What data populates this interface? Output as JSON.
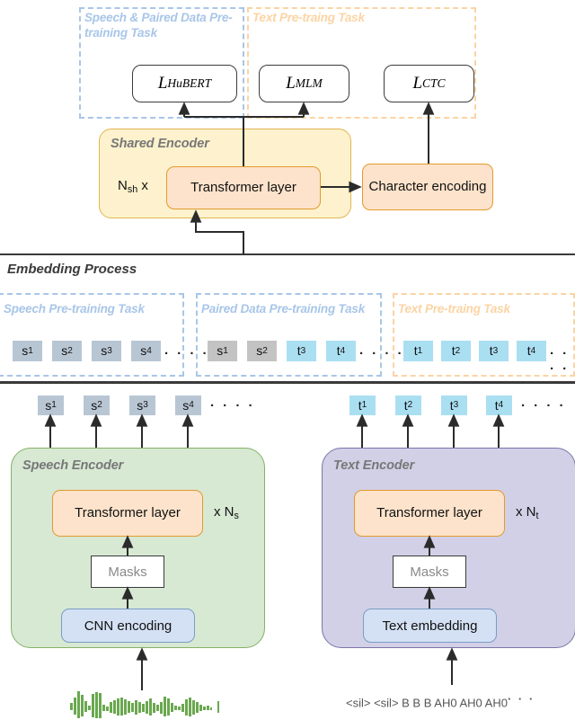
{
  "diagram": {
    "title_sections": {
      "embedding_process": "Embedding Process"
    },
    "pretraining_tasks": [
      {
        "id": "speech-paired",
        "label": "Speech & Paired Data Pre-training Task",
        "color": "#a8c6e8"
      },
      {
        "id": "text",
        "label": "Text Pre-traing Task",
        "color": "#fbd4a4"
      }
    ],
    "losses": [
      {
        "id": "hubert",
        "base": "L",
        "subscript": "HuBERT"
      },
      {
        "id": "mlm",
        "base": "L",
        "subscript": "MLM"
      },
      {
        "id": "ctc",
        "base": "L",
        "subscript": "CTC"
      }
    ],
    "shared_encoder": {
      "title": "Shared Encoder",
      "repeat_label_base": "N",
      "repeat_label_sub": "sh",
      "repeat_label_suffix": " x",
      "transformer_label": "Transformer layer",
      "character_encoding_label": "Character encoding",
      "fill": "#fdf2cd",
      "border": "#e3b54f"
    },
    "embedding_tasks": [
      {
        "id": "speech",
        "label": "Speech Pre-training Task",
        "color": "#a8c6e8",
        "tokens": [
          {
            "base": "s",
            "sub": "1",
            "kind": "sblue"
          },
          {
            "base": "s",
            "sub": "2",
            "kind": "sblue"
          },
          {
            "base": "s",
            "sub": "3",
            "kind": "sblue"
          },
          {
            "base": "s",
            "sub": "4",
            "kind": "sblue"
          }
        ],
        "ellipsis": "· · · ·"
      },
      {
        "id": "paired",
        "label": "Paired Data Pre-training Task",
        "color": "#a8c6e8",
        "tokens": [
          {
            "base": "s",
            "sub": "1",
            "kind": "sgray"
          },
          {
            "base": "s",
            "sub": "2",
            "kind": "sgray"
          },
          {
            "base": "t",
            "sub": "3",
            "kind": "t"
          },
          {
            "base": "t",
            "sub": "4",
            "kind": "t"
          }
        ],
        "ellipsis": "· · · ·"
      },
      {
        "id": "text",
        "label": "Text Pre-traing Task",
        "color": "#fbd4a4",
        "tokens": [
          {
            "base": "t",
            "sub": "1",
            "kind": "t"
          },
          {
            "base": "t",
            "sub": "2",
            "kind": "t"
          },
          {
            "base": "t",
            "sub": "3",
            "kind": "t"
          },
          {
            "base": "t",
            "sub": "4",
            "kind": "t"
          }
        ],
        "ellipsis": "· · · ·"
      }
    ],
    "speech_encoder": {
      "title": "Speech Encoder",
      "transformer_label": "Transformer  layer",
      "repeat_label_prefix": "x N",
      "repeat_label_sub": "s",
      "masks_label": "Masks",
      "input_label": "CNN encoding",
      "outputs": [
        {
          "base": "s",
          "sub": "1"
        },
        {
          "base": "s",
          "sub": "2"
        },
        {
          "base": "s",
          "sub": "3"
        },
        {
          "base": "s",
          "sub": "4"
        }
      ],
      "ellipsis": "· · · ·",
      "fill": "#d7e8d3",
      "border": "#85b267",
      "waveform_color": "#6aa84f"
    },
    "text_encoder": {
      "title": "Text Encoder",
      "transformer_label": "Transformer  layer",
      "repeat_label_prefix": "x N",
      "repeat_label_sub": "t",
      "masks_label": "Masks",
      "input_label": "Text embedding",
      "outputs": [
        {
          "base": "t",
          "sub": "1"
        },
        {
          "base": "t",
          "sub": "2"
        },
        {
          "base": "t",
          "sub": "3"
        },
        {
          "base": "t",
          "sub": "4"
        }
      ],
      "ellipsis": "· · · ·",
      "phoneme_sequence": "<sil> <sil> B B B AH0 AH0 AH0",
      "phoneme_ellipsis": "· · ·",
      "fill": "#d2d0e6",
      "border": "#7a75a8"
    }
  }
}
